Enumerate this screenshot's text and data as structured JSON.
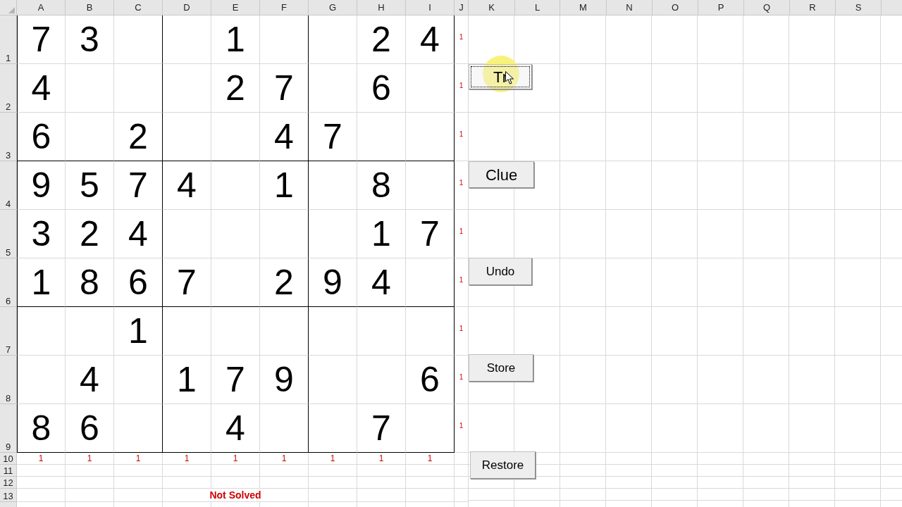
{
  "columns": [
    "A",
    "B",
    "C",
    "D",
    "E",
    "F",
    "G",
    "H",
    "I",
    "J",
    "K",
    "L",
    "M",
    "N",
    "O",
    "P",
    "Q",
    "R",
    "S"
  ],
  "row_headers": [
    "1",
    "2",
    "3",
    "4",
    "5",
    "6",
    "7",
    "8",
    "9",
    "10",
    "11",
    "12",
    "13"
  ],
  "grid": [
    {
      "A": "7",
      "B": "3",
      "E": "1",
      "H": "2",
      "I": "4"
    },
    {
      "A": "4",
      "E": "2",
      "F": "7",
      "H": "6"
    },
    {
      "A": "6",
      "C": "2",
      "F": "4",
      "G": "7"
    },
    {
      "A": "9",
      "B": "5",
      "C": "7",
      "D": "4",
      "F": "1",
      "H": "8"
    },
    {
      "A": "3",
      "B": "2",
      "C": "4",
      "H": "1",
      "I": "7"
    },
    {
      "A": "1",
      "B": "8",
      "C": "6",
      "D": "7",
      "F": "2",
      "G": "9",
      "H": "4"
    },
    {
      "C": "1"
    },
    {
      "B": "4",
      "D": "1",
      "E": "7",
      "F": "9",
      "I": "6"
    },
    {
      "A": "8",
      "B": "6",
      "E": "4",
      "H": "7"
    }
  ],
  "row_checks": [
    "1",
    "1",
    "1",
    "1",
    "1",
    "1",
    "1",
    "1",
    "1"
  ],
  "column_checks": [
    "1",
    "1",
    "1",
    "1",
    "1",
    "1",
    "1",
    "1",
    "1"
  ],
  "status": "Not Solved",
  "buttons": [
    {
      "label": "Tr",
      "focused": true
    },
    {
      "label": "Clue",
      "focused": false
    },
    {
      "label": "Undo",
      "focused": false
    },
    {
      "label": "Store",
      "focused": false
    },
    {
      "label": "Restore",
      "focused": false
    }
  ]
}
